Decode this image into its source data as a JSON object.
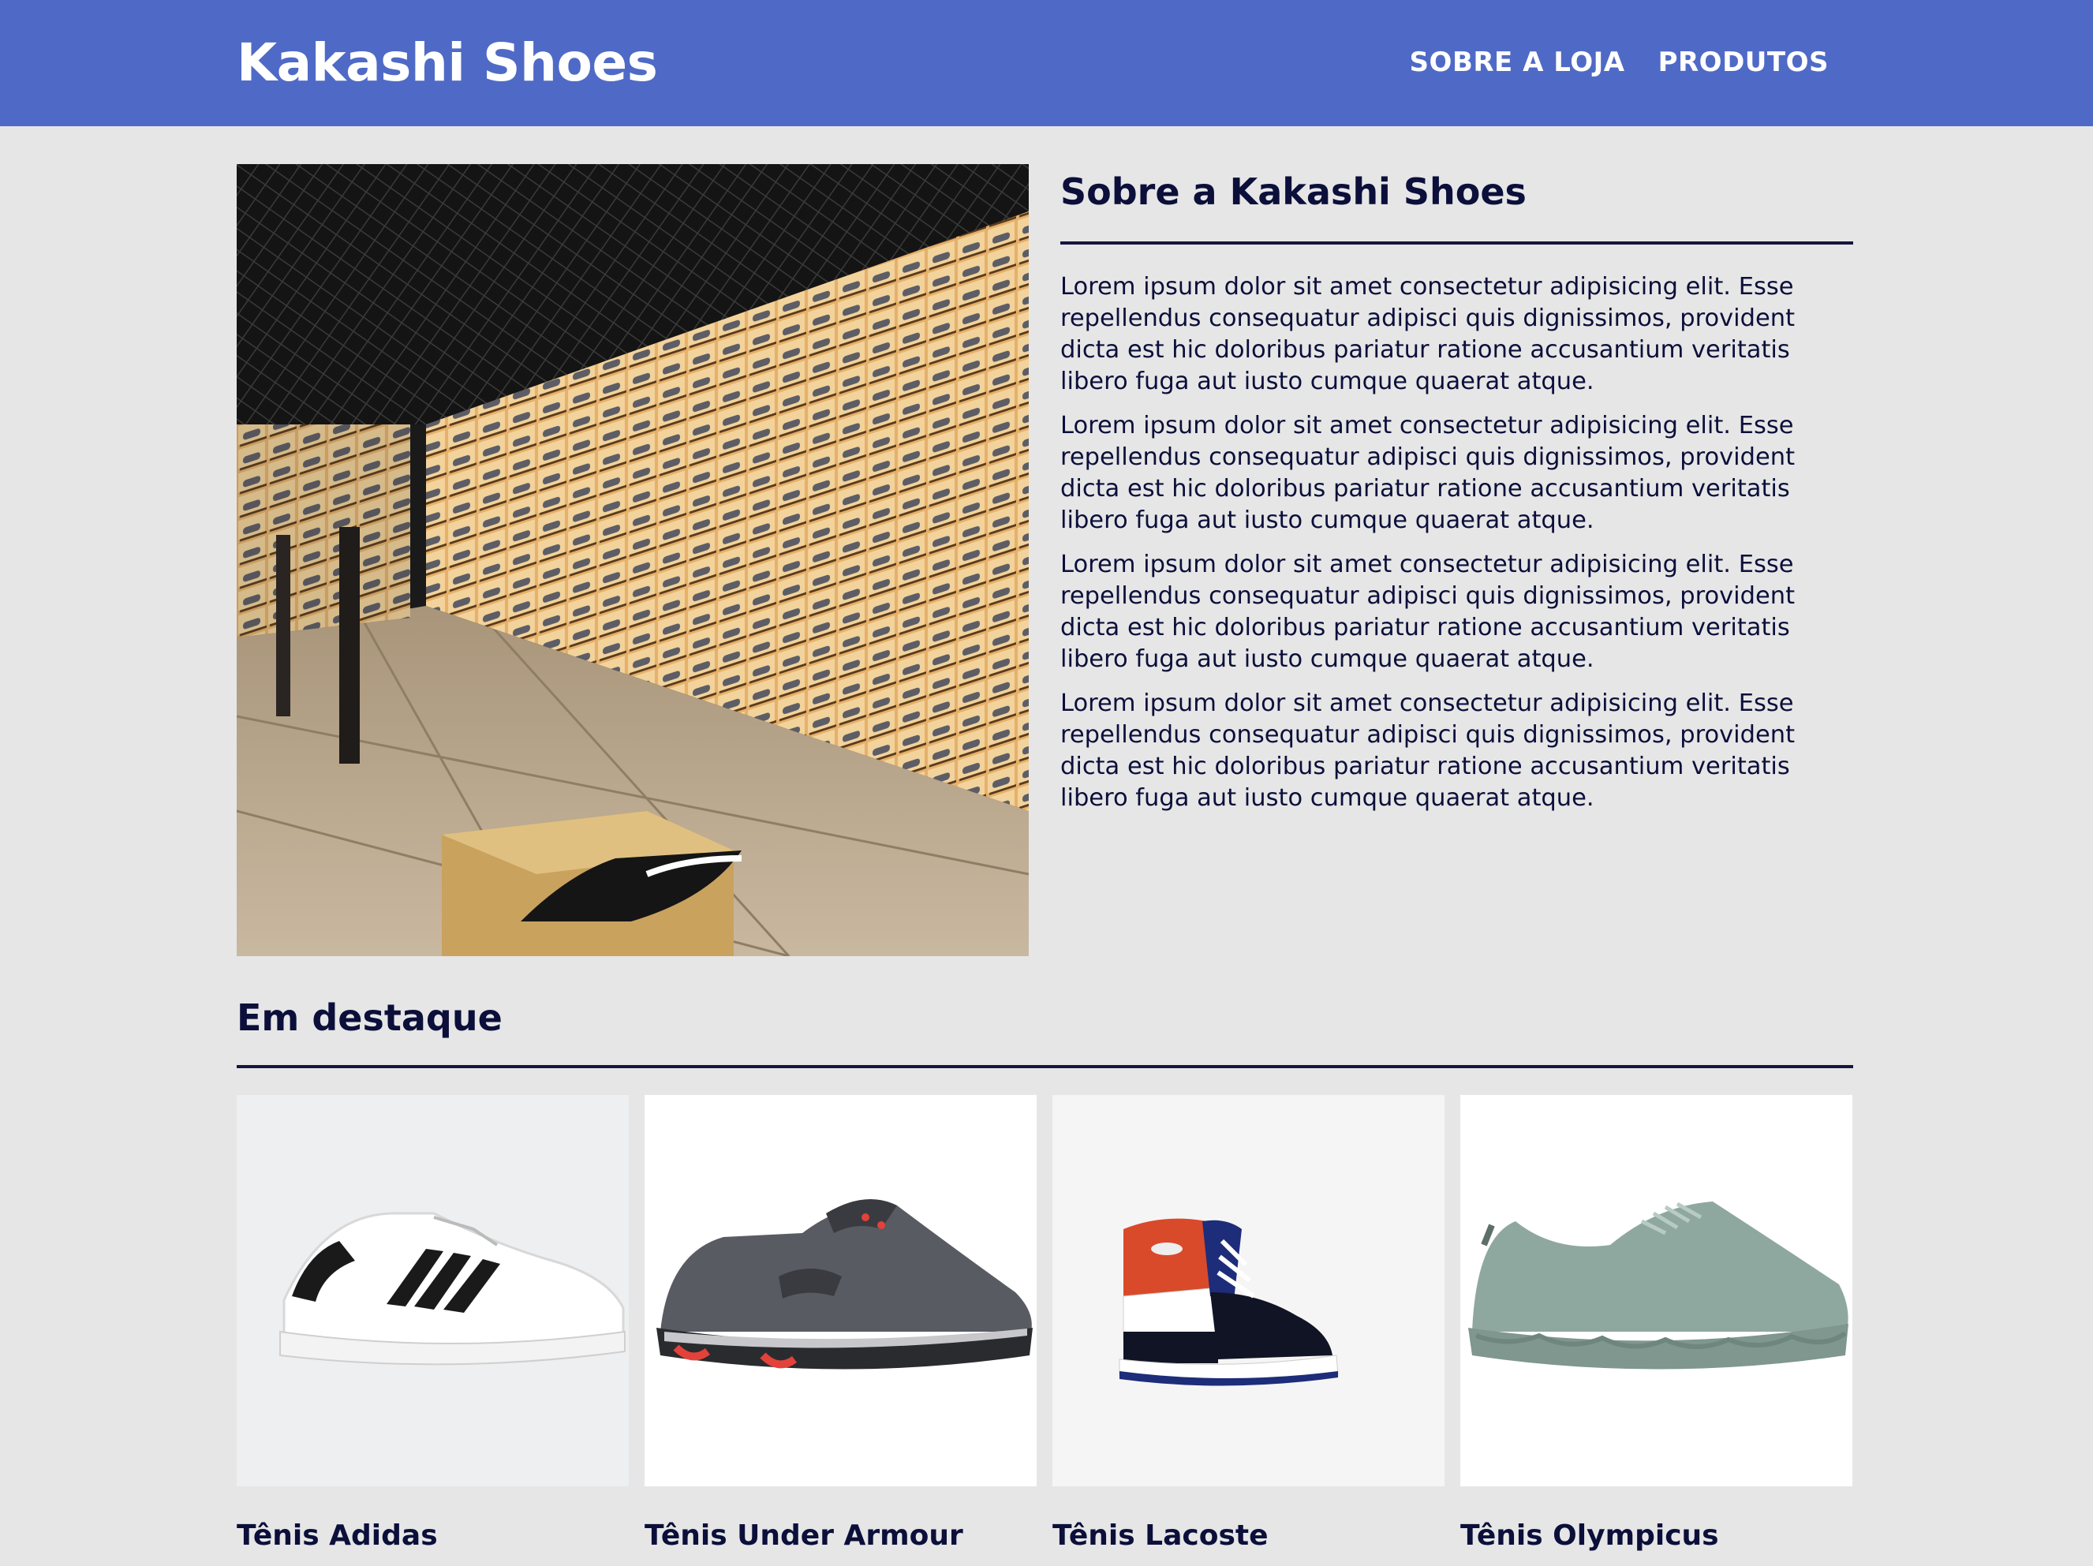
{
  "header": {
    "brand": "Kakashi Shoes",
    "nav": [
      "SOBRE A LOJA",
      "PRODUTOS"
    ]
  },
  "about": {
    "title": "Sobre a Kakashi Shoes",
    "paragraphs": [
      "Lorem ipsum dolor sit amet consectetur adipisicing elit. Esse repellendus consequatur adipisci quis dignissimos, provident dicta est hic doloribus pariatur ratione accusantium veritatis libero fuga aut iusto cumque quaerat atque.",
      "Lorem ipsum dolor sit amet consectetur adipisicing elit. Esse repellendus consequatur adipisci quis dignissimos, provident dicta est hic doloribus pariatur ratione accusantium veritatis libero fuga aut iusto cumque quaerat atque.",
      "Lorem ipsum dolor sit amet consectetur adipisicing elit. Esse repellendus consequatur adipisci quis dignissimos, provident dicta est hic doloribus pariatur ratione accusantium veritatis libero fuga aut iusto cumque quaerat atque.",
      "Lorem ipsum dolor sit amet consectetur adipisicing elit. Esse repellendus consequatur adipisci quis dignissimos, provident dicta est hic doloribus pariatur ratione accusantium veritatis libero fuga aut iusto cumque quaerat atque."
    ]
  },
  "featured": {
    "title": "Em destaque",
    "products": [
      {
        "name": "Tênis Adidas"
      },
      {
        "name": "Tênis Under Armour"
      },
      {
        "name": "Tênis Lacoste"
      },
      {
        "name": "Tênis Olympicus"
      }
    ]
  },
  "colors": {
    "header_bg": "#4f6ac6",
    "page_bg": "#e6e6e6",
    "text": "#0b0f3a"
  }
}
